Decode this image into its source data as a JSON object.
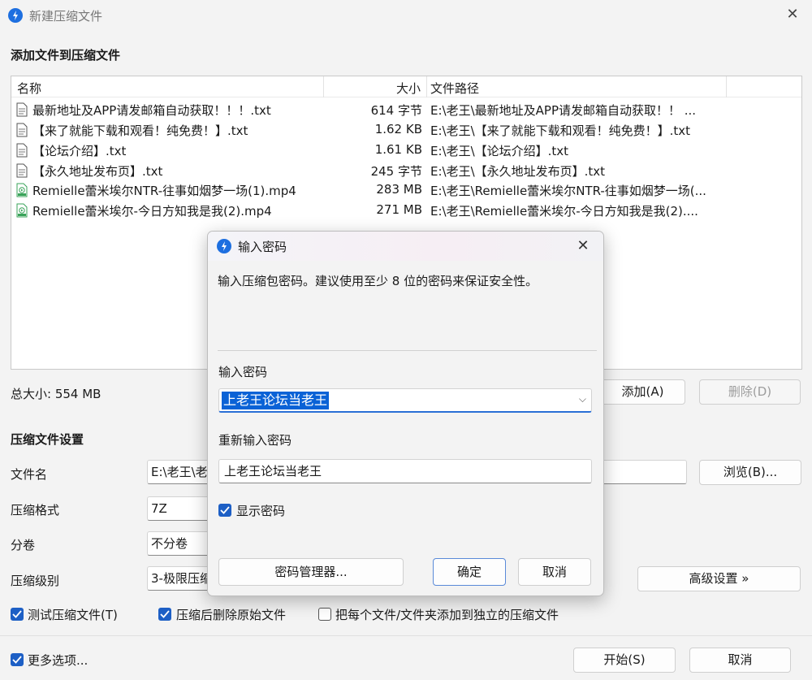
{
  "window": {
    "title": "新建压缩文件",
    "close_glyph": "✕"
  },
  "section_files": {
    "title": "添加文件到压缩文件"
  },
  "filelist": {
    "columns": {
      "name": "名称",
      "size": "大小",
      "path": "文件路径"
    },
    "rows": [
      {
        "name": "最新地址及APP请发邮箱自动获取！！！.txt",
        "size": "614 字节",
        "path": "E:\\老王\\最新地址及APP请发邮箱自动获取！！ ...",
        "icon": "text-file-icon"
      },
      {
        "name": "【来了就能下载和观看！纯免费！】.txt",
        "size": "1.62 KB",
        "path": "E:\\老王\\【来了就能下载和观看！纯免费！】.txt",
        "icon": "text-file-icon"
      },
      {
        "name": "【论坛介绍】.txt",
        "size": "1.61 KB",
        "path": "E:\\老王\\【论坛介绍】.txt",
        "icon": "text-file-icon"
      },
      {
        "name": "【永久地址发布页】.txt",
        "size": "245 字节",
        "path": "E:\\老王\\【永久地址发布页】.txt",
        "icon": "text-file-icon"
      },
      {
        "name": "Remielle蕾米埃尔NTR-往事如烟梦一场(1).mp4",
        "size": "283 MB",
        "path": "E:\\老王\\Remielle蕾米埃尔NTR-往事如烟梦一场(...",
        "icon": "video-file-icon"
      },
      {
        "name": "Remielle蕾米埃尔-今日方知我是我(2).mp4",
        "size": "271 MB",
        "path": "E:\\老王\\Remielle蕾米埃尔-今日方知我是我(2)....",
        "icon": "video-file-icon"
      }
    ]
  },
  "total": {
    "label": "总大小: 554 MB"
  },
  "file_buttons": {
    "add": "添加(A)",
    "remove": "删除(D)"
  },
  "settings": {
    "title": "压缩文件设置",
    "filename_label": "文件名",
    "filename_value": "E:\\老王\\老",
    "browse": "浏览(B)...",
    "format_label": "压缩格式",
    "format_value": "7Z",
    "split_label": "分卷",
    "split_value": "不分卷",
    "level_label": "压缩级别",
    "level_value": "3-极限压缩",
    "advanced": "高级设置 »"
  },
  "options": {
    "test": "测试压缩文件(T)",
    "delete_after": "压缩后删除原始文件",
    "separate": "把每个文件/文件夹添加到独立的压缩文件",
    "more": "更多选项..."
  },
  "bottom": {
    "start": "开始(S)",
    "cancel": "取消"
  },
  "dialog": {
    "title": "输入密码",
    "close_glyph": "✕",
    "message": "输入压缩包密码。建议使用至少 8 位的密码来保证安全性。",
    "password_label": "输入密码",
    "password_value": "上老王论坛当老王",
    "reenter_label": "重新输入密码",
    "reenter_value": "上老王论坛当老王",
    "show_password": "显示密码",
    "manager": "密码管理器...",
    "ok": "确定",
    "cancel": "取消",
    "chevron_glyph": "⌵"
  },
  "colors": {
    "accent": "#1d5fc5",
    "selection": "#0a62d6"
  }
}
